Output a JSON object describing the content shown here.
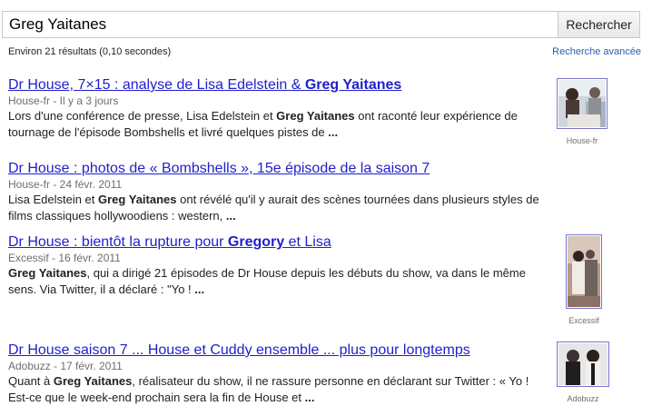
{
  "search": {
    "query": "Greg Yaitanes",
    "button_label": "Rechercher"
  },
  "stats": "Environ 21 résultats (0,10 secondes)",
  "advanced_search": "Recherche avancée",
  "results": [
    {
      "title_parts": [
        "Dr House, 7×15 : analyse de Lisa Edelstein & ",
        "Greg Yaitanes",
        ""
      ],
      "meta": "House-fr - Il y a 3 jours",
      "snippet_lines": [
        [
          "Lors d'une conférence de presse, Lisa Edelstein et ",
          "Greg Yaitanes",
          " ont raconté leur expérience de"
        ],
        [
          "tournage de l'épisode Bombshells et livré quelques pistes de ",
          "...",
          ""
        ]
      ],
      "thumb_source": "House-fr"
    },
    {
      "title_parts": [
        "Dr House : photos de « Bombshells », 15e épisode de la saison 7",
        "",
        ""
      ],
      "meta": "House-fr - 24 févr. 2011",
      "snippet_lines": [
        [
          "Lisa Edelstein et ",
          "Greg Yaitanes",
          " ont révélé qu'il y aurait des scènes tournées dans plusieurs styles de"
        ],
        [
          "films classiques hollywoodiens : western, ",
          "...",
          ""
        ]
      ]
    },
    {
      "title_parts": [
        "Dr House : bientôt la rupture pour ",
        "Gregory",
        " et Lisa"
      ],
      "meta": "Excessif - 16 févr. 2011",
      "snippet_lines": [
        [
          "",
          "Greg Yaitanes",
          ", qui a dirigé 21 épisodes de Dr House depuis les débuts du show, va dans le même"
        ],
        [
          "sens. Via Twitter, il a déclaré : \"Yo ! ",
          "...",
          ""
        ]
      ],
      "thumb_source": "Excessif"
    },
    {
      "title_parts": [
        "Dr House saison 7 ... House et Cuddy ensemble ... plus pour longtemps",
        "",
        ""
      ],
      "meta": "Adobuzz - 17 févr. 2011",
      "snippet_lines": [
        [
          "Quant à ",
          "Greg Yaitanes",
          ", réalisateur du show, il ne rassure personne en déclarant sur Twitter : « Yo !"
        ],
        [
          "Est-ce que le week-end prochain sera la fin de House et ",
          "...",
          ""
        ]
      ],
      "thumb_source": "Adobuzz"
    }
  ]
}
